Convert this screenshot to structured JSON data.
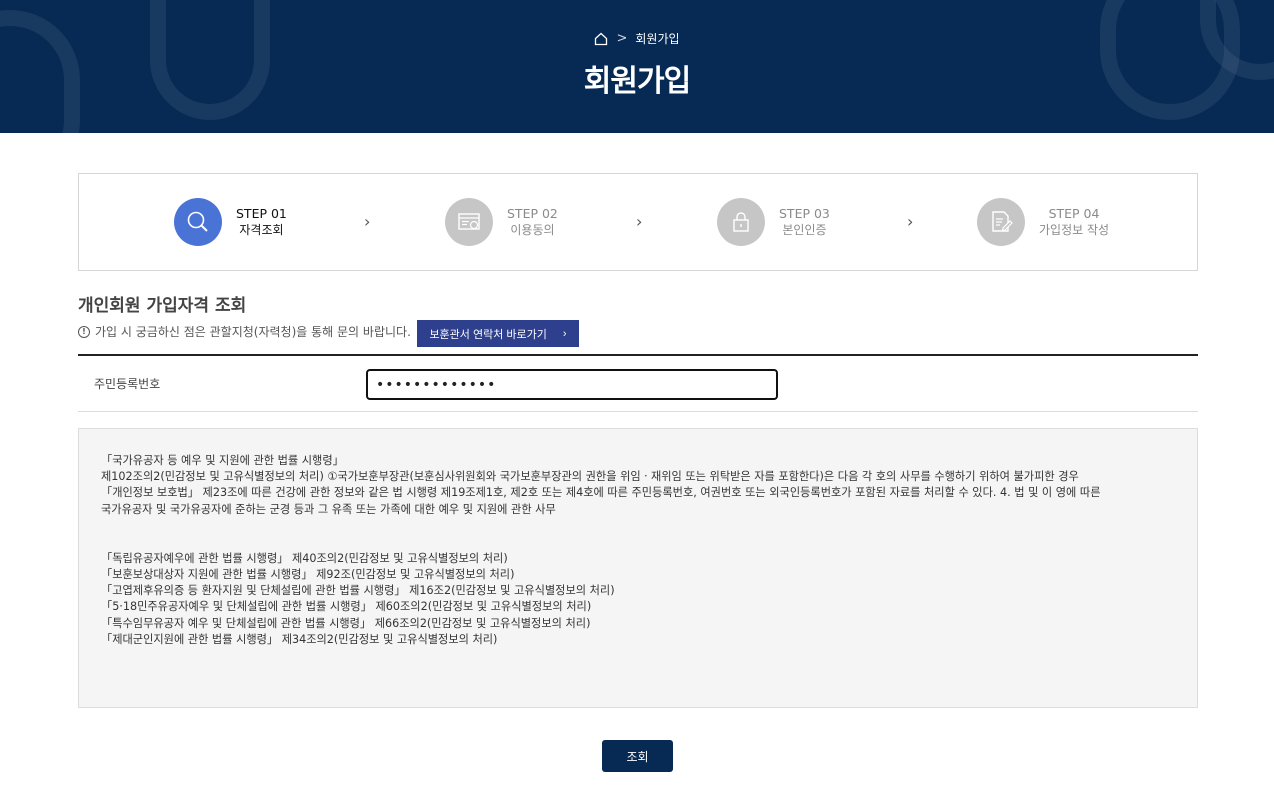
{
  "header": {
    "breadcrumb_icon": "home-icon",
    "breadcrumb_sep": ">",
    "breadcrumb_current": "회원가입",
    "title": "회원가입"
  },
  "steps": [
    {
      "num": "STEP 01",
      "label": "자격조회",
      "icon": "search-icon",
      "active": true
    },
    {
      "num": "STEP 02",
      "label": "이용동의",
      "icon": "document-check-icon",
      "active": false
    },
    {
      "num": "STEP 03",
      "label": "본인인증",
      "icon": "lock-icon",
      "active": false
    },
    {
      "num": "STEP 04",
      "label": "가입정보 작성",
      "icon": "edit-document-icon",
      "active": false
    }
  ],
  "step_arrow": "›",
  "section": {
    "title": "개인회원 가입자격 조회",
    "notice_icon": "!",
    "notice": "가입 시 궁금하신 점은 관할지청(자력청)을 통해 문의 바랍니다.",
    "contact_button": "보훈관서 연락처 바로가기",
    "contact_button_arrow": "›"
  },
  "form": {
    "ssn_label": "주민등록번호",
    "ssn_value": "•••••••••••••"
  },
  "terms": {
    "lines_1": [
      "「국가유공자 등 예우 및 지원에 관한 법률 시행령」",
      "제102조의2(민감정보 및 고유식별정보의 처리) ①국가보훈부장관(보훈심사위원회와 국가보훈부장관의 권한을 위임ㆍ재위임 또는 위탁받은 자를 포함한다)은 다음 각 호의 사무를 수행하기 위하여 불가피한 경우",
      "「개인정보 보호법」 제23조에 따른 건강에 관한 정보와 같은 법 시행령 제19조제1호, 제2호 또는 제4호에 따른 주민등록번호, 여권번호 또는 외국인등록번호가 포함된 자료를 처리할 수 있다. 4. 법 및 이 영에 따른",
      "국가유공자 및 국가유공자에 준하는 군경 등과 그 유족 또는 가족에 대한 예우 및 지원에 관한 사무"
    ],
    "lines_2": [
      "「독립유공자예우에 관한 법률 시행령」 제40조의2(민감정보 및 고유식별정보의 처리)",
      "「보훈보상대상자 지원에 관한 법률 시행령」 제92조(민감정보 및 고유식별정보의 처리)",
      "「고엽제후유의증 등 환자지원 및 단체설립에 관한 법률 시행령」 제16조2(민감정보 및 고유식별정보의 처리)",
      "「5·18민주유공자예우 및 단체설립에 관한 법률 시행령」 제60조의2(민감정보 및 고유식별정보의 처리)",
      "「특수임무유공자 예우 및 단체설립에 관한 법률 시행령」 제66조의2(민감정보 및 고유식별정보의 처리)",
      "「제대군인지원에 관한 법률 시행령」 제34조의2(민감정보 및 고유식별정보의 처리)"
    ]
  },
  "submit_label": "조회",
  "colors": {
    "header_bg": "#072a54",
    "step_active": "#4a73d6",
    "step_inactive": "#c6c6c6",
    "contact_btn": "#2e3f8e",
    "submit_btn": "#072a54"
  }
}
